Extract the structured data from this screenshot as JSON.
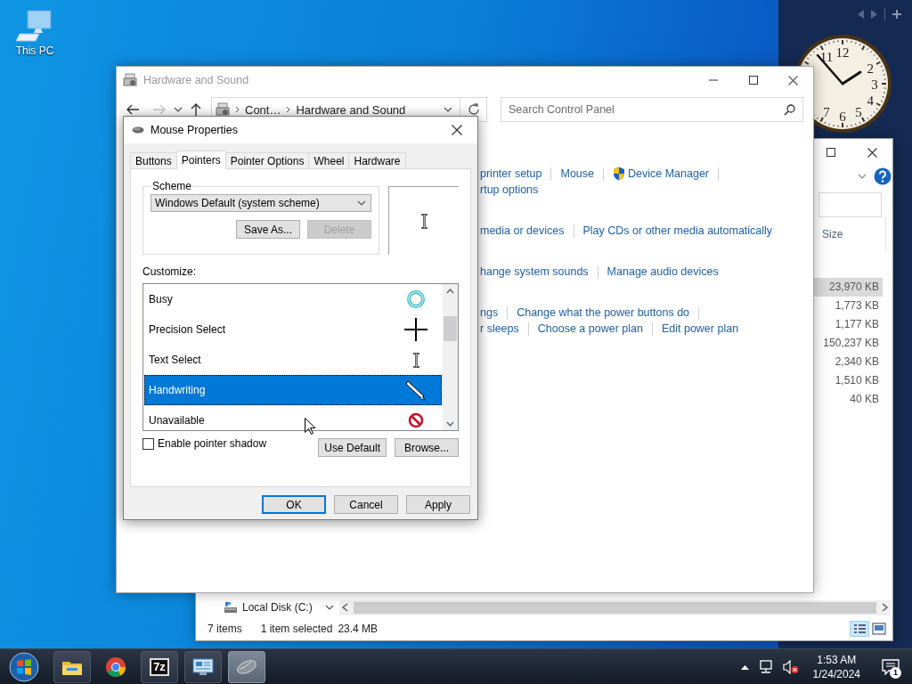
{
  "desktop_icons": [
    {
      "label": "This PC"
    }
  ],
  "clock_gadget": {
    "numerals": [
      {
        "text": "11"
      },
      {
        "text": "12"
      },
      {
        "text": "2"
      },
      {
        "text": "3"
      },
      {
        "text": "4"
      },
      {
        "text": "5"
      },
      {
        "text": "6"
      },
      {
        "text": "7"
      }
    ]
  },
  "explorer": {
    "column": "Size",
    "rows": [
      {
        "size": "23,970 KB",
        "selected": true
      },
      {
        "size": "1,773 KB",
        "selected": false
      },
      {
        "size": "1,177 KB",
        "selected": false
      },
      {
        "size": "150,237 KB",
        "selected": false
      },
      {
        "size": "2,340 KB",
        "selected": false
      },
      {
        "size": "1,510 KB",
        "selected": false
      },
      {
        "size": "40 KB",
        "selected": false
      }
    ],
    "nav_item": "Local Disk (C:)",
    "status": [
      "7 items",
      "1 item selected",
      "23.4 MB"
    ]
  },
  "control_panel": {
    "title": "Hardware and Sound",
    "breadcrumb": [
      "Cont…",
      "Hardware and Sound"
    ],
    "search": {
      "placeholder": "Search Control Panel"
    },
    "groups": [
      {
        "rows": [
          {
            "links": [
              {
                "text": "printer setup",
                "shield": false
              },
              {
                "text": "Mouse",
                "shield": false
              },
              {
                "text": "Device Manager",
                "shield": true
              }
            ],
            "trailing_separator": true
          },
          {
            "links": [
              {
                "text": "rtup options",
                "shield": false
              }
            ],
            "trailing_separator": false
          }
        ]
      },
      {
        "rows": [
          {
            "links": [
              {
                "text": "media or devices",
                "shield": false
              },
              {
                "text": "Play CDs or other media automatically",
                "shield": false
              }
            ],
            "trailing_separator": false
          }
        ]
      },
      {
        "rows": [
          {
            "links": [
              {
                "text": "hange system sounds",
                "shield": false
              },
              {
                "text": "Manage audio devices",
                "shield": false
              }
            ],
            "trailing_separator": false
          }
        ]
      },
      {
        "rows": [
          {
            "links": [
              {
                "text": "ngs",
                "shield": false
              },
              {
                "text": "Change what the power buttons do",
                "shield": false
              }
            ],
            "trailing_separator": true
          },
          {
            "links": [
              {
                "text": "r sleeps",
                "shield": false
              },
              {
                "text": "Choose a power plan",
                "shield": false
              },
              {
                "text": "Edit power plan",
                "shield": false
              }
            ],
            "trailing_separator": false
          }
        ]
      }
    ]
  },
  "mouse_dialog": {
    "title": "Mouse Properties",
    "tabs": [
      {
        "label": "Buttons",
        "selected": false
      },
      {
        "label": "Pointers",
        "selected": true
      },
      {
        "label": "Pointer Options",
        "selected": false
      },
      {
        "label": "Wheel",
        "selected": false
      },
      {
        "label": "Hardware",
        "selected": false
      }
    ],
    "scheme": {
      "label": "Scheme",
      "value": "Windows Default (system scheme)",
      "buttons": [
        {
          "label": "Save As...",
          "disabled": false
        },
        {
          "label": "Delete",
          "disabled": true
        }
      ]
    },
    "preview": {
      "kind": "text"
    },
    "customize_label": "Customize:",
    "cursors": [
      {
        "name": "Busy",
        "kind": "busy",
        "selected": false
      },
      {
        "name": "Precision Select",
        "kind": "cross",
        "selected": false
      },
      {
        "name": "Text Select",
        "kind": "text",
        "selected": false
      },
      {
        "name": "Handwriting",
        "kind": "pen",
        "selected": true
      },
      {
        "name": "Unavailable",
        "kind": "unavailable",
        "selected": false
      }
    ],
    "shadow": {
      "label": "Enable pointer shadow",
      "checked": false
    },
    "buttons": [
      "Use Default",
      "Browse..."
    ],
    "footer_buttons": [
      {
        "label": "OK",
        "default": true
      },
      {
        "label": "Cancel",
        "default": false
      },
      {
        "label": "Apply",
        "default": false
      }
    ]
  },
  "taskbar": {
    "apps": [
      {
        "kind": "folder",
        "running": true,
        "active": false
      },
      {
        "kind": "browser",
        "running": false,
        "active": false
      },
      {
        "kind": "archiver",
        "label": "7z",
        "running": true,
        "active": false
      },
      {
        "kind": "control",
        "running": true,
        "active": false
      },
      {
        "kind": "mouse",
        "running": true,
        "active": true
      }
    ],
    "time": "1:53 AM",
    "date": "1/24/2024",
    "notifications": "1"
  }
}
